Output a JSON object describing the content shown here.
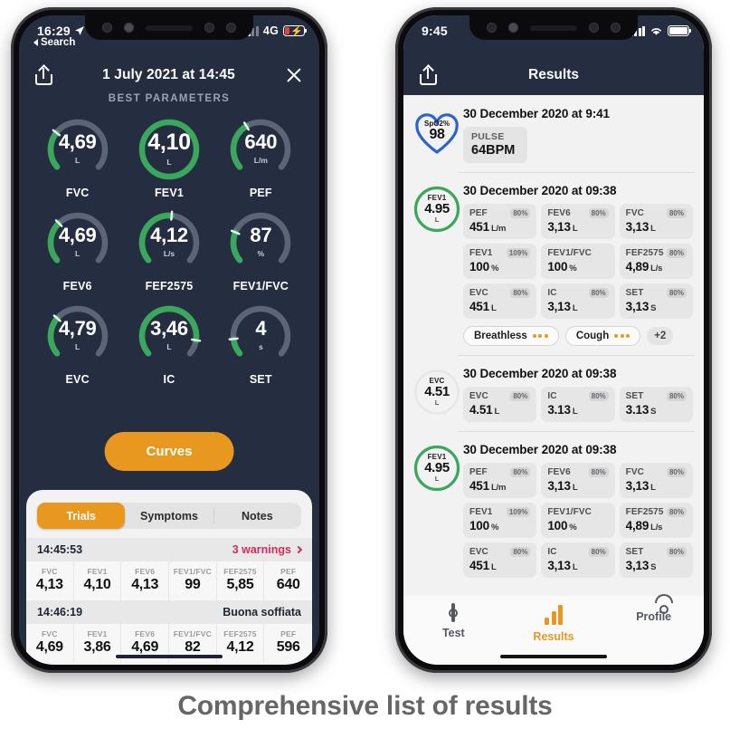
{
  "caption": "Comprehensive list of results",
  "colors": {
    "dark_navy": "#252d41",
    "green": "#3aa85c",
    "orange": "#e8971f",
    "warning_red": "#d6295b",
    "blue": "#2f63c8",
    "track_gray": "#5c6578"
  },
  "left_phone": {
    "status": {
      "time": "16:29",
      "location_icon": "location-arrow-icon",
      "network": "4G",
      "signal_icon": "signal-bars-icon",
      "battery_icon": "battery-charging-icon"
    },
    "back_label": "Search",
    "nav": {
      "share_icon": "share-icon",
      "title": "1 July 2021 at 14:45",
      "close_icon": "close-icon"
    },
    "section_label": "BEST PARAMETERS",
    "gauges": [
      {
        "value": "4,69",
        "unit": "L",
        "name": "FVC",
        "percent": 30,
        "highlight": false
      },
      {
        "value": "4,10",
        "unit": "L",
        "name": "FEV1",
        "percent": 100,
        "highlight": true
      },
      {
        "value": "640",
        "unit": "L/m",
        "name": "PEF",
        "percent": 38,
        "highlight": false
      },
      {
        "value": "4,69",
        "unit": "L",
        "name": "FEV6",
        "percent": 33,
        "highlight": false
      },
      {
        "value": "4,12",
        "unit": "L/s",
        "name": "FEF2575",
        "percent": 52,
        "highlight": false
      },
      {
        "value": "87",
        "unit": "%",
        "name": "FEV1/FVC",
        "percent": 24,
        "highlight": false
      },
      {
        "value": "4,79",
        "unit": "L",
        "name": "EVC",
        "percent": 31,
        "highlight": false
      },
      {
        "value": "3,46",
        "unit": "L",
        "name": "IC",
        "percent": 88,
        "highlight": false
      },
      {
        "value": "4",
        "unit": "s",
        "name": "SET",
        "percent": 13,
        "highlight": false
      }
    ],
    "curves_button": "Curves",
    "tabs": [
      {
        "label": "Trials",
        "active": true
      },
      {
        "label": "Symptoms",
        "active": false
      },
      {
        "label": "Notes",
        "active": false
      }
    ],
    "trials": [
      {
        "time": "14:45:53",
        "status": "3 warnings",
        "status_type": "warning",
        "chevron_icon": "chevron-right-icon",
        "metrics": [
          {
            "key": "FVC",
            "value": "4,13"
          },
          {
            "key": "FEV1",
            "value": "4,10"
          },
          {
            "key": "FEV6",
            "value": "4,13"
          },
          {
            "key": "FEV1/FVC",
            "value": "99"
          },
          {
            "key": "FEF2575",
            "value": "5,85"
          },
          {
            "key": "PEF",
            "value": "640"
          }
        ]
      },
      {
        "time": "14:46:19",
        "status": "Buona soffiata",
        "status_type": "good",
        "metrics": [
          {
            "key": "FVC",
            "value": "4,69"
          },
          {
            "key": "FEV1",
            "value": "3,86"
          },
          {
            "key": "FEV6",
            "value": "4,69"
          },
          {
            "key": "FEV1/FVC",
            "value": "82"
          },
          {
            "key": "FEF2575",
            "value": "4,12"
          },
          {
            "key": "PEF",
            "value": "596"
          }
        ]
      }
    ]
  },
  "right_phone": {
    "status": {
      "time": "9:45",
      "signal_icon": "signal-bars-icon",
      "wifi_icon": "wifi-icon",
      "battery_icon": "battery-full-icon"
    },
    "nav": {
      "share_icon": "share-icon",
      "title": "Results"
    },
    "results": [
      {
        "badge_type": "heart",
        "badge_key": "SpO2%",
        "badge_value": "98",
        "date": "30 December 2020 at 9:41",
        "pulse": {
          "label": "PULSE",
          "value": "64BPM"
        },
        "metrics": [],
        "chips": []
      },
      {
        "badge_type": "ring",
        "badge_key": "FEV1",
        "badge_value": "4.95",
        "badge_unit": "L",
        "badge_highlight": true,
        "date": "30 December 2020 at 09:38",
        "metrics": [
          {
            "key": "PEF",
            "pct": "80%",
            "value": "451",
            "unit": "L/m"
          },
          {
            "key": "FEV6",
            "pct": "80%",
            "value": "3,13",
            "unit": "L"
          },
          {
            "key": "FVC",
            "pct": "80%",
            "value": "3,13",
            "unit": "L"
          },
          {
            "key": "FEV1",
            "pct": "109%",
            "value": "100",
            "unit": "%"
          },
          {
            "key": "FEV1/FVC",
            "pct": "",
            "value": "100",
            "unit": "%"
          },
          {
            "key": "FEF2575",
            "pct": "80%",
            "value": "4,89",
            "unit": "L/s"
          },
          {
            "key": "EVC",
            "pct": "80%",
            "value": "451",
            "unit": "L"
          },
          {
            "key": "IC",
            "pct": "80%",
            "value": "3,13",
            "unit": "L"
          },
          {
            "key": "SET",
            "pct": "80%",
            "value": "3,13",
            "unit": "S"
          }
        ],
        "chips": [
          {
            "label": "Breathless",
            "dots": 3
          },
          {
            "label": "Cough",
            "dots": 3
          }
        ],
        "chips_more": "+2"
      },
      {
        "badge_type": "ring",
        "badge_key": "EVC",
        "badge_value": "4.51",
        "badge_unit": "L",
        "badge_highlight": false,
        "date": "30 December 2020 at 09:38",
        "metrics": [
          {
            "key": "EVC",
            "pct": "80%",
            "value": "4.51",
            "unit": "L"
          },
          {
            "key": "IC",
            "pct": "80%",
            "value": "3.13",
            "unit": "L"
          },
          {
            "key": "SET",
            "pct": "80%",
            "value": "3.13",
            "unit": "S"
          }
        ],
        "chips": []
      },
      {
        "badge_type": "ring",
        "badge_key": "FEV1",
        "badge_value": "4.95",
        "badge_unit": "L",
        "badge_highlight": true,
        "date": "30 December 2020 at 09:38",
        "metrics": [
          {
            "key": "PEF",
            "pct": "80%",
            "value": "451",
            "unit": "L/m"
          },
          {
            "key": "FEV6",
            "pct": "80%",
            "value": "3,13",
            "unit": "L"
          },
          {
            "key": "FVC",
            "pct": "80%",
            "value": "3,13",
            "unit": "L"
          },
          {
            "key": "FEV1",
            "pct": "109%",
            "value": "100",
            "unit": "%"
          },
          {
            "key": "FEV1/FVC",
            "pct": "",
            "value": "100",
            "unit": "%"
          },
          {
            "key": "FEF2575",
            "pct": "80%",
            "value": "4,89",
            "unit": "L/s"
          },
          {
            "key": "EVC",
            "pct": "80%",
            "value": "451",
            "unit": "L"
          },
          {
            "key": "IC",
            "pct": "80%",
            "value": "3,13",
            "unit": "L"
          },
          {
            "key": "SET",
            "pct": "80%",
            "value": "3,13",
            "unit": "S"
          }
        ],
        "chips": []
      }
    ],
    "tabbar": [
      {
        "label": "Test",
        "icon": "test-device-icon",
        "active": false
      },
      {
        "label": "Results",
        "icon": "bar-chart-icon",
        "active": true
      },
      {
        "label": "Profile",
        "icon": "person-icon",
        "active": false
      }
    ]
  }
}
